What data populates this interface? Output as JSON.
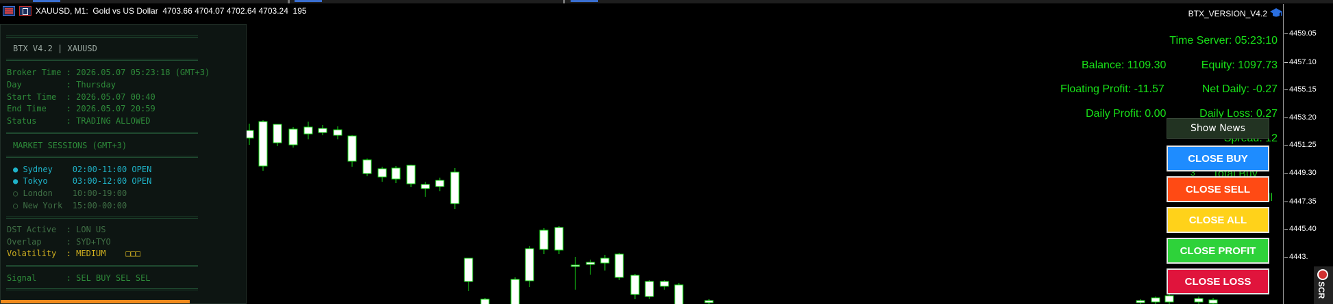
{
  "window": {
    "symbol_title": "XAUUSD, M1:  Gold vs US Dollar  4703.66 4704.07 4702.64 4703.24  195",
    "version": "BTX_VERSION_V4.2"
  },
  "price_scale": [
    "4459.05",
    "4457.10",
    "4455.15",
    "4453.20",
    "4451.25",
    "4449.30",
    "4447.35",
    "4445.40",
    "4443."
  ],
  "info_panel": {
    "title": "BTX V4.2 | XAUUSD",
    "broker_time": "Broker Time : 2026.05.07 05:23:18 (GMT+3)",
    "day": "Day         : Thursday",
    "start_time": "Start Time  : 2026.05.07 00:40",
    "end_time": "End Time    : 2026.05.07 20:59",
    "status": "Status      : TRADING ALLOWED",
    "sessions_header": "MARKET SESSIONS (GMT+3)",
    "sessions": [
      {
        "text": "● Sydney    02:00-11:00 OPEN",
        "state": "open"
      },
      {
        "text": "● Tokyo     03:00-12:00 OPEN",
        "state": "open"
      },
      {
        "text": "○ London    10:00-19:00",
        "state": "closed"
      },
      {
        "text": "○ New York  15:00-00:00",
        "state": "closed"
      }
    ],
    "dst_active": "DST Active  : LON US",
    "overlap": "Overlap     : SYD+TYO",
    "volatility": "Volatility  : MEDIUM    □□□",
    "signal": "Signal      : SEL BUY SEL SEL"
  },
  "stats": {
    "time_server": "Time Server: 05:23:10",
    "balance": "Balance: 1109.30",
    "equity": "Equity: 1097.73",
    "floating_profit": "Floating Profit: -11.57",
    "net_daily": "Net Daily: -0.27",
    "daily_profit": "Daily Profit: 0.00",
    "daily_loss": "Daily Loss: 0.27",
    "spread": "Spread: 12",
    "total_buy": "Total Buy",
    "sell_partial": "ell",
    "buy_count_partial": "3"
  },
  "buttons": {
    "show_news": "Show News",
    "close_buy": "CLOSE BUY",
    "close_sell": "CLOSE SELL",
    "close_all": "CLOSE ALL",
    "close_profit": "CLOSE PROFIT",
    "close_loss": "CLOSE LOSS"
  },
  "colors": {
    "bull_candle": "#ffffff",
    "candle_outline": "#18e018",
    "stat_text": "#18e018",
    "close_buy": "#1e8cff",
    "close_sell": "#ff4a14",
    "close_all": "#ffd21a",
    "close_profit": "#2ed23a",
    "close_loss": "#e0143c"
  },
  "side_tab": "SCR"
}
